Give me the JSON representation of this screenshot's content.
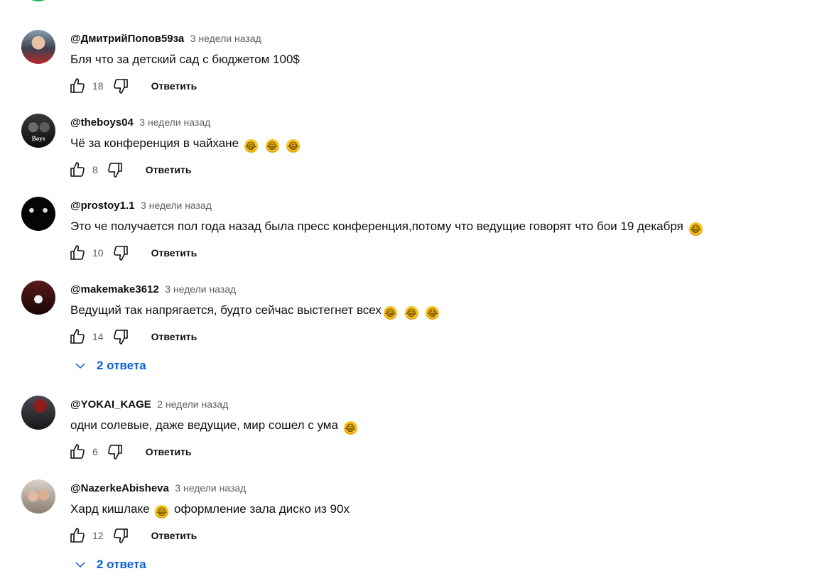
{
  "reply_label": "Ответить",
  "comments": [
    {
      "author": "@ДмитрийПопов59за",
      "time": "3 недели назад",
      "text": "Бля что за детский сад с бюджетом 100$",
      "likes": "18"
    },
    {
      "author": "@theboys04",
      "time": "3 недели назад",
      "text": "Чё за конференция в чайхане",
      "likes": "8",
      "avatar_text": "Boys"
    },
    {
      "author": "@prostoy1.1",
      "time": "3 недели назад",
      "text": "Это че получается пол года назад была пресс конференция,потому что ведущие говорят что бои 19 декабря",
      "likes": "10"
    },
    {
      "author": "@makemake3612",
      "time": "3 недели назад",
      "text": "Ведущий так напрягается, будто сейчас выстегнет всех",
      "likes": "14"
    },
    {
      "author": "@YOKAI_KAGE",
      "time": "2 недели назад",
      "text": "одни солевые, даже ведущие, мир сошел с ума",
      "likes": "6"
    },
    {
      "author": "@NazerkeAbisheva",
      "time": "3 недели назад",
      "text_a": "Хард кишлаке",
      "text_b": "оформление зала диско из 90х",
      "likes": "12"
    }
  ],
  "replies_toggles": [
    "2 ответа",
    "2 ответа"
  ],
  "emoji": "😂",
  "icons": {
    "like": "thumbs-up-icon",
    "dislike": "thumbs-down-icon",
    "expand": "chevron-down-icon"
  },
  "colors": {
    "link": "#065fd4",
    "meta": "#606060",
    "text": "#0f0f0f"
  }
}
